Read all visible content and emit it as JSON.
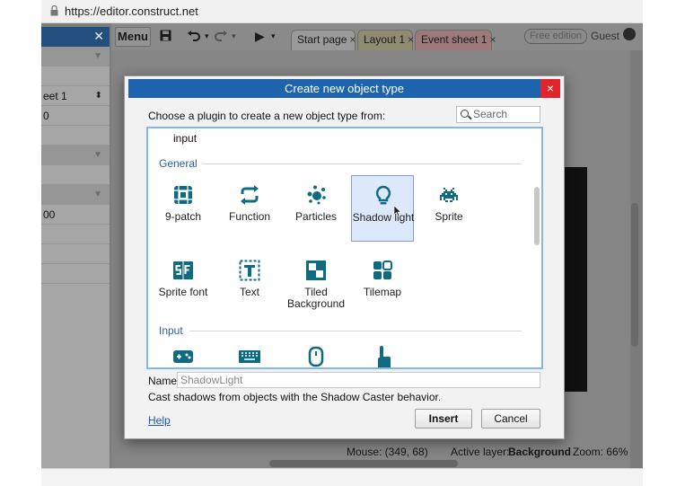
{
  "browser": {
    "url": "https://editor.construct.net"
  },
  "left_panel": {
    "rows": [
      "",
      "",
      "eet 1",
      "0",
      "",
      "",
      "",
      "00",
      "",
      "",
      "",
      ""
    ]
  },
  "toolbar": {
    "menu_label": "Menu",
    "tabs": [
      {
        "label": "Start page",
        "close": "×"
      },
      {
        "label": "Layout 1",
        "close": "×"
      },
      {
        "label": "Event sheet 1",
        "close": "×"
      }
    ],
    "edition_badge": "Free edition",
    "user_label": "Guest"
  },
  "statusbar": {
    "mouse": "Mouse: (349, 68)",
    "layer_prefix": "Active layer:",
    "layer_name": "Background",
    "zoom": "Zoom: 66%"
  },
  "dialog": {
    "title": "Create new object type",
    "close_glyph": "×",
    "prompt": "Choose a plugin to create a new object type from:",
    "search_placeholder": "Search",
    "cut_off_item": "input",
    "sections": [
      {
        "title": "General",
        "items": [
          {
            "icon": "nine-patch-icon",
            "label": "9-patch"
          },
          {
            "icon": "function-icon",
            "label": "Function"
          },
          {
            "icon": "particles-icon",
            "label": "Particles"
          },
          {
            "icon": "lightbulb-icon",
            "label": "Shadow light",
            "selected": true
          },
          {
            "icon": "space-invader-icon",
            "label": "Sprite"
          },
          {
            "icon": "sprite-font-icon",
            "label": "Sprite font"
          },
          {
            "icon": "text-icon",
            "label": "Text"
          },
          {
            "icon": "tiled-background-icon",
            "label": "Tiled Background"
          },
          {
            "icon": "tilemap-icon",
            "label": "Tilemap"
          }
        ]
      },
      {
        "title": "Input",
        "items": [
          {
            "icon": "gamepad-icon",
            "label": ""
          },
          {
            "icon": "keyboard-icon",
            "label": ""
          },
          {
            "icon": "mouse-icon",
            "label": ""
          },
          {
            "icon": "touch-icon",
            "label": ""
          }
        ]
      }
    ],
    "name_label": "Name",
    "name_value": "ShadowLight",
    "description": "Cast shadows from objects with the Shadow Caster behavior.",
    "help_link": "Help",
    "insert_label": "Insert",
    "cancel_label": "Cancel"
  },
  "colors": {
    "title_bar": "#1d63ad",
    "close_button": "#e0242b",
    "icon_teal": "#0f6b82",
    "section_text": "#2d5ca6",
    "selection_bg": "#dde8fa"
  }
}
